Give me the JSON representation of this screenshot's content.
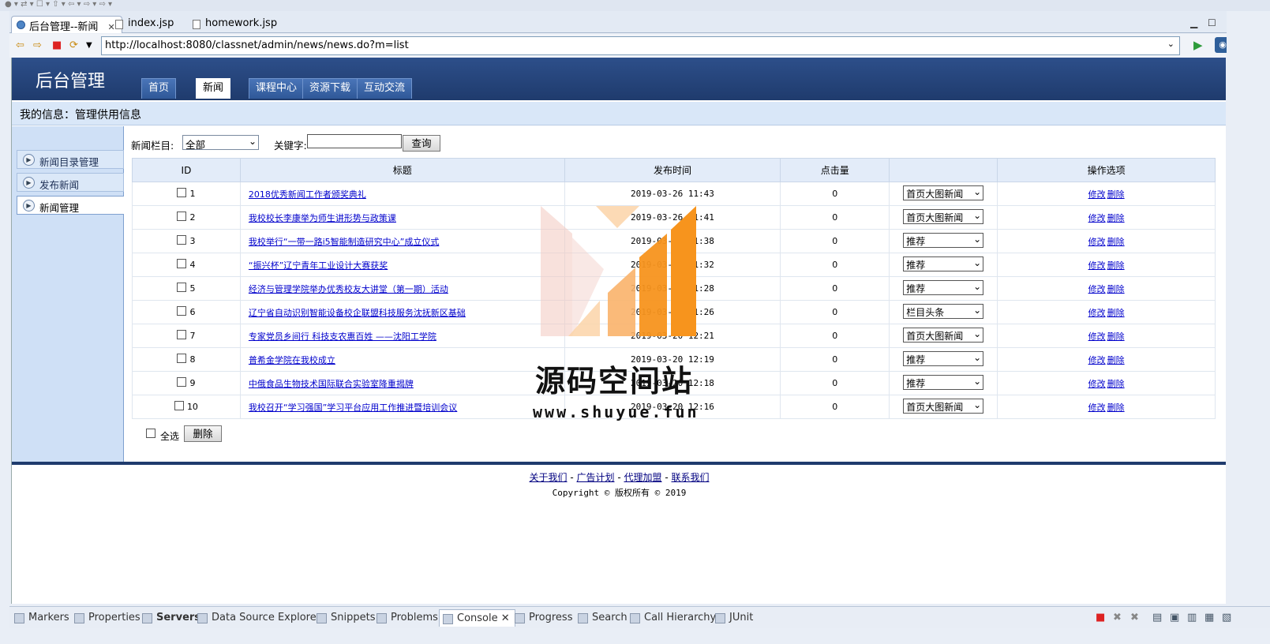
{
  "browser": {
    "tabs": [
      {
        "label": "后台管理--新闻",
        "close": "✕"
      },
      {
        "label": "index.jsp"
      },
      {
        "label": "homework.jsp"
      }
    ],
    "url": "http://localhost:8080/classnet/admin/news/news.do?m=list"
  },
  "site": {
    "title": "后台管理",
    "nav": [
      "首页",
      "新闻",
      "课程中心",
      "资源下载",
      "互动交流"
    ],
    "info": "我的信息：管理供用信息"
  },
  "sidebar": {
    "items": [
      {
        "label": "新闻目录管理"
      },
      {
        "label": "发布新闻"
      },
      {
        "label": "新闻管理"
      }
    ]
  },
  "filter": {
    "category_label": "新闻栏目:",
    "category_value": "全部",
    "keyword_label": "关键字:",
    "keyword_value": "",
    "search_button": "查询"
  },
  "table": {
    "headers": [
      "ID",
      "标题",
      "发布时间",
      "点击量",
      "",
      "操作选项"
    ],
    "rows": [
      {
        "id": "1",
        "title": "2018优秀新闻工作者颁奖典礼",
        "date": "2019-03-26 11:43",
        "clicks": "0",
        "type": "首页大图新闻"
      },
      {
        "id": "2",
        "title": "我校校长李康举为师生讲形势与政策课",
        "date": "2019-03-26 11:41",
        "clicks": "0",
        "type": "首页大图新闻"
      },
      {
        "id": "3",
        "title": "我校举行“一带一路i5智能制造研究中心”成立仪式",
        "date": "2019-03-26 11:38",
        "clicks": "0",
        "type": "推荐"
      },
      {
        "id": "4",
        "title": "“振兴杯”辽宁青年工业设计大赛获奖",
        "date": "2019-03-26 11:32",
        "clicks": "0",
        "type": "推荐"
      },
      {
        "id": "5",
        "title": "经济与管理学院举办优秀校友大讲堂（第一期）活动",
        "date": "2019-03-26 11:28",
        "clicks": "0",
        "type": "推荐"
      },
      {
        "id": "6",
        "title": "辽宁省自动识别智能设备校企联盟科技服务沈抚新区基础",
        "date": "2019-03-26 11:26",
        "clicks": "0",
        "type": "栏目头条"
      },
      {
        "id": "7",
        "title": "专家党员乡间行 科技支农惠百姓 ——沈阳工学院",
        "date": "2019-03-20 12:21",
        "clicks": "0",
        "type": "首页大图新闻"
      },
      {
        "id": "8",
        "title": "普希金学院在我校成立",
        "date": "2019-03-20 12:19",
        "clicks": "0",
        "type": "推荐"
      },
      {
        "id": "9",
        "title": "中俄食品生物技术国际联合实验室降重揭牌",
        "date": "2019-03-20 12:18",
        "clicks": "0",
        "type": "推荐"
      },
      {
        "id": "10",
        "title": "我校召开“学习强国”学习平台应用工作推进暨培训会议",
        "date": "2019-03-20 12:16",
        "clicks": "0",
        "type": "首页大图新闻"
      }
    ],
    "edit_label": "修改",
    "delete_label": "删除"
  },
  "bottom": {
    "select_all": "全选",
    "delete_button": "删除"
  },
  "footer": {
    "links": [
      "关于我们",
      "广告计划",
      "代理加盟",
      "联系我们"
    ],
    "sep": " - ",
    "copyright": "Copyright © 版权所有 © 2019"
  },
  "watermark": {
    "text": "源码空间站",
    "url": "www.shuyue.fun"
  },
  "ide_bottom": {
    "tabs": [
      "Markers",
      "Properties",
      "Servers",
      "Data Source Explorer",
      "Snippets",
      "Problems",
      "Console",
      "Progress",
      "Search",
      "Call Hierarchy",
      "JUnit"
    ],
    "active": "Console",
    "close": "✕"
  },
  "colors": {
    "header_blue": "#1f3b6d",
    "link_blue": "#0000cc",
    "watermark_orange": "#f7941d"
  }
}
